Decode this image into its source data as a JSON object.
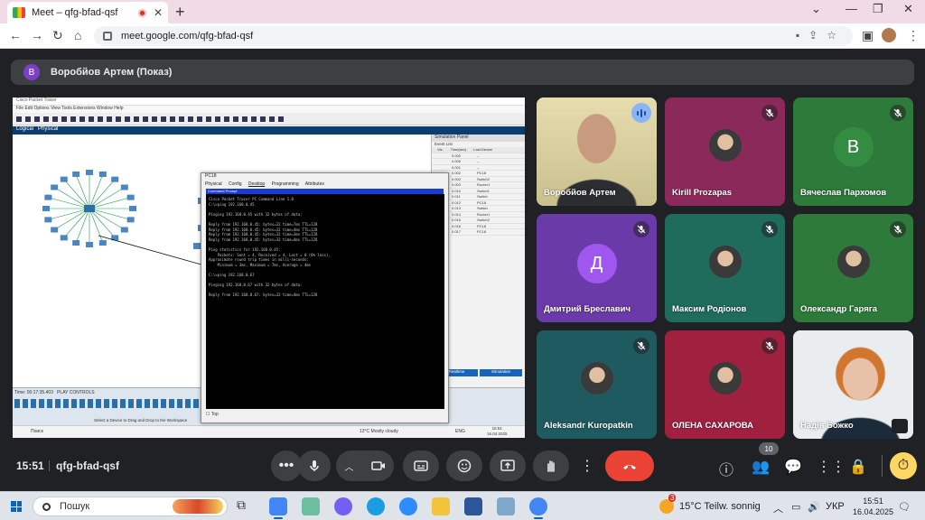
{
  "browser": {
    "tab_title": "Meet – qfg-bfad-qsf",
    "url": "meet.google.com/qfg-bfad-qsf"
  },
  "presenter": {
    "avatar_letter": "B",
    "label": "Воробйов Артем (Показ)"
  },
  "shared_screen": {
    "app_title": "Cisco Packet Tracer",
    "tabs": [
      "Logical",
      "Physical"
    ],
    "pc_window_title": "PC18",
    "pc_window_tabs": [
      "Physical",
      "Config",
      "Desktop",
      "Programming",
      "Attributes"
    ],
    "cmd_header": "Command Prompt",
    "cmd_lines": [
      "Cisco Packet Tracer PC Command Line 1.0",
      "C:\\>ping 192.168.0.45",
      "",
      "Pinging 192.168.0.45 with 32 bytes of data:",
      "",
      "Reply from 192.168.0.45: bytes=32 time=7ms TTL=128",
      "Reply from 192.168.0.45: bytes=32 time=4ms TTL=128",
      "Reply from 192.168.0.45: bytes=32 time=3ms TTL=128",
      "Reply from 192.168.0.45: bytes=32 time=4ms TTL=128",
      "",
      "Ping statistics for 192.168.0.45:",
      "    Packets: Sent = 4, Received = 4, Lost = 0 (0% loss),",
      "Approximate round trip times in milli-seconds:",
      "    Minimum = 3ms, Maximum = 7ms, Average = 4ms",
      "",
      "C:\\>ping 192.168.0.67",
      "",
      "Pinging 192.168.0.67 with 32 bytes of data:",
      "",
      "Reply from 192.168.0.67: bytes=32 time=4ms TTL=128"
    ],
    "cmd_footer": "Top",
    "sim_panel_title": "Simulation Panel",
    "sim_panel_subtitle": "Event List",
    "sim_columns": [
      "Vis.",
      "Time(sec)",
      "Last Device"
    ],
    "sim_rows": [
      [
        "",
        "0.000",
        "--"
      ],
      [
        "",
        "0.000",
        "--"
      ],
      [
        "",
        "0.001",
        "--"
      ],
      [
        "",
        "0.002",
        "PC18"
      ],
      [
        "",
        "0.002",
        "Switch2"
      ],
      [
        "",
        "0.003",
        "Router1"
      ],
      [
        "",
        "0.010",
        "Switch1"
      ],
      [
        "",
        "0.011",
        "Switch"
      ],
      [
        "",
        "0.012",
        "PC18"
      ],
      [
        "",
        "0.013",
        "Switch"
      ],
      [
        "",
        "0.014",
        "Router1"
      ],
      [
        "",
        "0.015",
        "Switch2"
      ],
      [
        "",
        "0.016",
        "PC18"
      ],
      [
        "",
        "0.017",
        "PC18"
      ]
    ],
    "sim_buttons": [
      "Realtime",
      "Simulation"
    ],
    "bottom_time": "Time: 00:17:35.403",
    "play_controls": "PLAY CONTROLS",
    "device_hint": "Select a Device to Drag and Drop to the Workspace",
    "taskbar_search": "Поиск",
    "weather": "13°C Mostly cloudy",
    "clock": "15:51",
    "date": "16.04.2025",
    "lang": "ENG"
  },
  "participants": [
    {
      "name": "Воробйов Артем",
      "type": "video",
      "speaking": true,
      "muted": false,
      "bg": "#d9d0a0"
    },
    {
      "name": "Kirill Prozapas",
      "type": "photo",
      "muted": true,
      "bg": "#8b2a5a"
    },
    {
      "name": "Вячеслав Пархомов",
      "type": "letter",
      "letter": "B",
      "muted": true,
      "bg": "#2d7a3a",
      "circle": "#2d7a3a"
    },
    {
      "name": "Дмитрий Бреславич",
      "type": "letter",
      "letter": "Д",
      "muted": true,
      "bg": "#6a3aa8",
      "circle": "#8a4cd0"
    },
    {
      "name": "Максим Родіонов",
      "type": "photo",
      "muted": true,
      "bg": "#1f6b5c"
    },
    {
      "name": "Олександр Гаряга",
      "type": "photo",
      "muted": true,
      "bg": "#2d7a3a"
    },
    {
      "name": "Aleksandr Kuropatkin",
      "type": "photo",
      "muted": true,
      "bg": "#1f5a60"
    },
    {
      "name": "ОЛЕНА САХАРОВА",
      "type": "photo",
      "muted": true,
      "bg": "#a02040"
    },
    {
      "name": "Надія Божко",
      "type": "video",
      "muted": false,
      "bg": "#d8dde2"
    }
  ],
  "controls": {
    "time": "15:51",
    "meeting_code": "qfg-bfad-qsf",
    "participants_count": "10"
  },
  "windows_taskbar": {
    "search_placeholder": "Пошук",
    "weather": "15°C  Teilw. sonnig",
    "lang": "УКР",
    "time": "15:51",
    "date": "16.04.2025",
    "notifications": "3"
  }
}
